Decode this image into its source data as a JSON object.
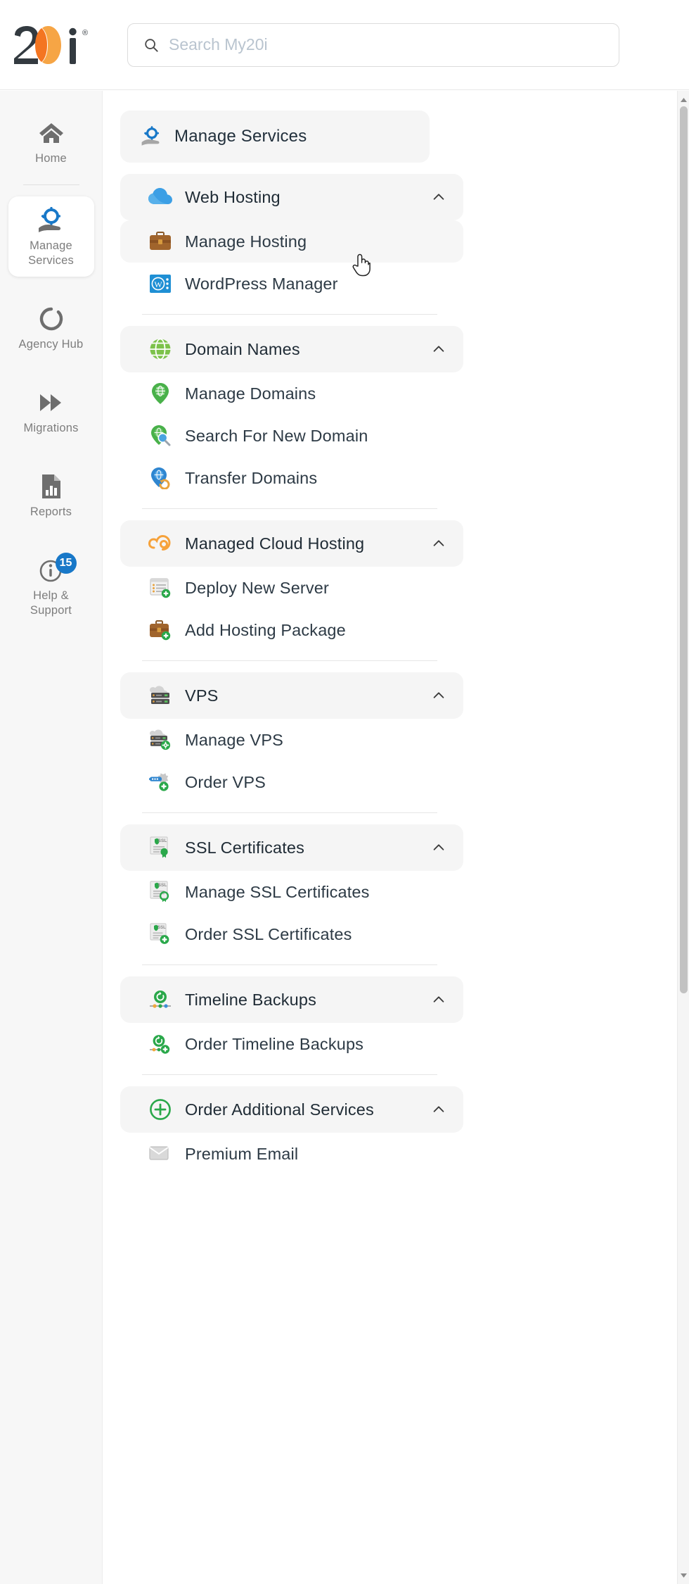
{
  "brand": {
    "logo_text": "20i",
    "logo_mark": "twenty-i-logo",
    "registered": "®"
  },
  "search": {
    "placeholder": "Search My20i",
    "value": "",
    "icon": "search-icon"
  },
  "rail": {
    "items": [
      {
        "label": "Home",
        "icon": "home-icon",
        "active": false,
        "badge": ""
      },
      {
        "label": "Manage Services",
        "icon": "manage-services-icon",
        "active": true,
        "badge": ""
      },
      {
        "label": "Agency Hub",
        "icon": "agency-hub-icon",
        "active": false,
        "badge": ""
      },
      {
        "label": "Migrations",
        "icon": "migrations-icon",
        "active": false,
        "badge": ""
      },
      {
        "label": "Reports",
        "icon": "reports-icon",
        "active": false,
        "badge": ""
      },
      {
        "label": "Help & Support",
        "icon": "help-support-icon",
        "active": false,
        "badge": "15"
      }
    ]
  },
  "menu": {
    "header": {
      "label": "Manage Services",
      "icon": "manage-services-icon"
    },
    "chevron": "chevron-up-icon",
    "groups": [
      {
        "label": "Web Hosting",
        "icon": "cloud-icon",
        "expanded": true,
        "items": [
          {
            "label": "Manage Hosting",
            "icon": "briefcase-icon",
            "hover": true
          },
          {
            "label": "WordPress Manager",
            "icon": "wordpress-icon",
            "hover": false
          }
        ]
      },
      {
        "label": "Domain Names",
        "icon": "globe-icon",
        "expanded": true,
        "items": [
          {
            "label": "Manage Domains",
            "icon": "map-pin-globe-icon",
            "hover": false
          },
          {
            "label": "Search For New Domain",
            "icon": "domain-search-icon",
            "hover": false
          },
          {
            "label": "Transfer Domains",
            "icon": "domain-transfer-icon",
            "hover": false
          }
        ]
      },
      {
        "label": "Managed Cloud Hosting",
        "icon": "managed-cloud-icon",
        "expanded": true,
        "items": [
          {
            "label": "Deploy New Server",
            "icon": "deploy-server-icon",
            "hover": false
          },
          {
            "label": "Add Hosting Package",
            "icon": "briefcase-add-icon",
            "hover": false
          }
        ]
      },
      {
        "label": "VPS",
        "icon": "server-icon",
        "expanded": true,
        "items": [
          {
            "label": "Manage VPS",
            "icon": "server-gear-icon",
            "hover": false
          },
          {
            "label": "Order VPS",
            "icon": "server-add-icon",
            "hover": false
          }
        ]
      },
      {
        "label": "SSL Certificates",
        "icon": "ssl-certificate-icon",
        "expanded": true,
        "items": [
          {
            "label": "Manage SSL Certificates",
            "icon": "ssl-manage-icon",
            "hover": false
          },
          {
            "label": "Order SSL Certificates",
            "icon": "ssl-add-icon",
            "hover": false
          }
        ]
      },
      {
        "label": "Timeline Backups",
        "icon": "timeline-backup-icon",
        "expanded": true,
        "items": [
          {
            "label": "Order Timeline Backups",
            "icon": "timeline-backup-add-icon",
            "hover": false
          }
        ]
      },
      {
        "label": "Order Additional Services",
        "icon": "plus-circle-icon",
        "expanded": true,
        "items": [
          {
            "label": "Premium Email",
            "icon": "premium-email-icon",
            "hover": false
          }
        ]
      }
    ]
  },
  "scrollbar": {
    "up_icon": "scroll-up-arrow-icon",
    "down_icon": "scroll-down-arrow-icon"
  },
  "cursor": {
    "icon": "pointer-hand-cursor"
  },
  "colors": {
    "accent_orange": "#f58220",
    "accent_blue": "#1878c8",
    "green": "#2aa84a",
    "panel_bg": "#ffffff",
    "rail_bg": "#f7f7f7",
    "row_hover": "#f5f5f5",
    "text": "#2d3a45"
  }
}
